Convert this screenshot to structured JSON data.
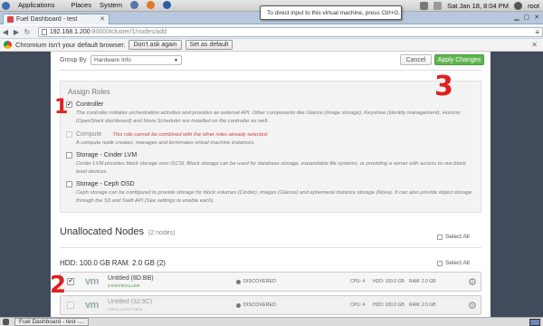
{
  "system_bar": {
    "menus": [
      "Applications",
      "Places",
      "System"
    ],
    "datetime": "Sat Jan 18,  8:04 PM",
    "user": "root"
  },
  "vm_tooltip": "To direct input to this virtual machine, press Ctrl+G.",
  "browser": {
    "tab_title": "Fuel Dashboard - test",
    "url_host": "192.168.1.200",
    "url_path": ":8000/#cluster/1/nodes/add",
    "infobar": {
      "message": "Chromium isn't your default browser.",
      "dont_ask": "Don't ask again",
      "set_default": "Set as default"
    }
  },
  "page": {
    "group_by_label": "Group By",
    "group_by_value": "Hardware Info",
    "cancel_label": "Cancel",
    "apply_label": "Apply Changes",
    "assign_roles_title": "Assign Roles",
    "roles": [
      {
        "name": "Controller",
        "checked": true,
        "disabled": false,
        "warning": "",
        "description": "The controller initiates orchestration activities and provides an external API. Other components like Glance (image storage), Keystone (identity management), Horizon (OpenStack dashboard) and Nova Scheduler are installed on the controller as well."
      },
      {
        "name": "Compute",
        "checked": false,
        "disabled": true,
        "warning": "This role cannot be combined with the other roles already selected.",
        "description": "A compute node creates, manages and terminates virtual machine instances."
      },
      {
        "name": "Storage - Cinder LVM",
        "checked": false,
        "disabled": false,
        "warning": "",
        "description": "Cinder LVM provides block storage over iSCSI. Block storage can be used for database storage, expandable file systems, or providing a server with access to raw block level devices."
      },
      {
        "name": "Storage - Ceph OSD",
        "checked": false,
        "disabled": false,
        "warning": "",
        "description": "Ceph storage can be configured to provide storage for block volumes (Cinder), images (Glance) and ephemeral instance storage (Nova). It can also provide object storage through the S3 and Swift API (See settings to enable each)."
      }
    ],
    "unallocated_title": "Unallocated Nodes",
    "unallocated_count": "(2 nodes)",
    "select_all_label": "Select All",
    "hardware_group": "HDD: 100.0 GB  RAM: 2.0 GB (2)",
    "nodes": [
      {
        "name": "Untitled (8D:BB)",
        "role": "CONTROLLER",
        "status": "DISCOVERED",
        "cpu": "CPU: 4",
        "hdd": "HDD: 100.0 GB",
        "ram": "RAM: 2.0 GB",
        "checked": true
      },
      {
        "name": "Untitled (32:9C)",
        "role": "UNALLOCATED",
        "status": "DISCOVERED",
        "cpu": "CPU: 4",
        "hdd": "HDD: 100.0 GB",
        "ram": "RAM: 2.0 GB",
        "checked": false
      }
    ]
  },
  "annotations": [
    "1",
    "2",
    "3"
  ],
  "taskbar": {
    "task_label": "Fuel Dashboard - test -..."
  },
  "colors": {
    "apply_green": "#5fb34e",
    "annotation_red": "#e0201e",
    "background_dark": "#404c5c"
  }
}
